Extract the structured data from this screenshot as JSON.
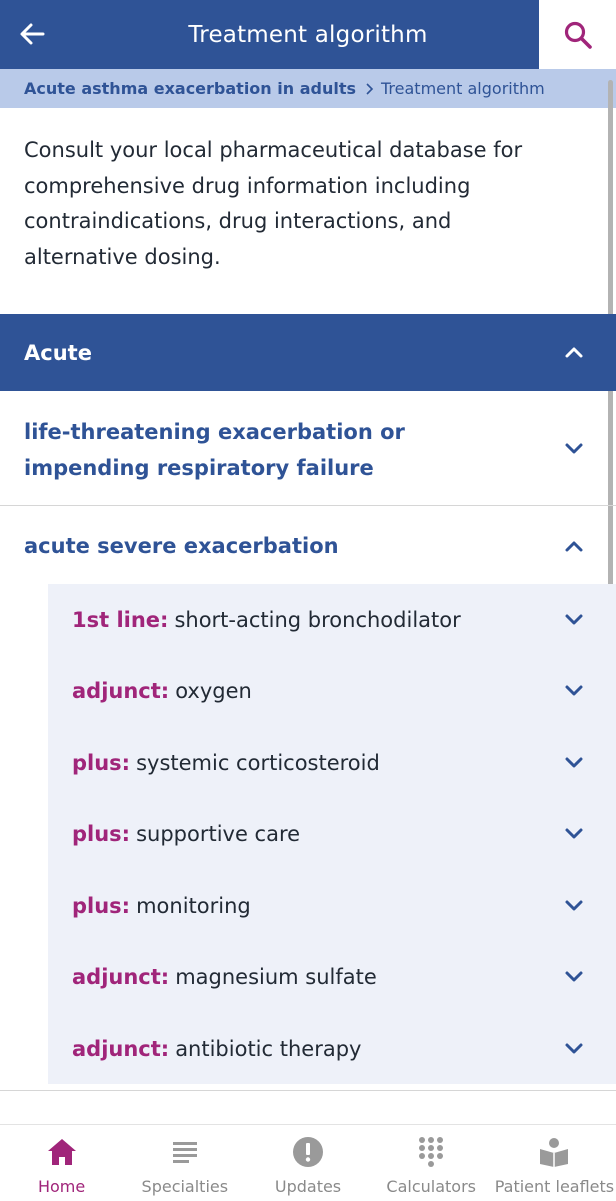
{
  "appbar": {
    "title": "Treatment algorithm"
  },
  "breadcrumb": {
    "parent": "Acute asthma exacerbation in adults",
    "current": "Treatment algorithm"
  },
  "intro": {
    "text": "Consult your local pharmaceutical database for comprehensive drug information including contraindications, drug interactions, and alternative dosing."
  },
  "section": {
    "title": "Acute",
    "expanded": true
  },
  "groups": [
    {
      "title": "life-threatening exacerbation or impending respiratory failure",
      "expanded": false
    },
    {
      "title": "acute severe exacerbation",
      "expanded": true
    }
  ],
  "treatments": [
    {
      "tag": "1st line:",
      "text": "short-acting bronchodilator"
    },
    {
      "tag": "adjunct:",
      "text": "oxygen"
    },
    {
      "tag": "plus:",
      "text": "systemic corticosteroid"
    },
    {
      "tag": "plus:",
      "text": "supportive care"
    },
    {
      "tag": "plus:",
      "text": "monitoring"
    },
    {
      "tag": "adjunct:",
      "text": "magnesium sulfate"
    },
    {
      "tag": "adjunct:",
      "text": "antibiotic therapy"
    }
  ],
  "bottom_nav": [
    {
      "label": "Home",
      "icon": "home-icon",
      "active": true
    },
    {
      "label": "Specialties",
      "icon": "list-icon",
      "active": false
    },
    {
      "label": "Updates",
      "icon": "alert-icon",
      "active": false
    },
    {
      "label": "Calculators",
      "icon": "keypad-icon",
      "active": false
    },
    {
      "label": "Patient leaflets",
      "icon": "leaflet-icon",
      "active": false
    }
  ],
  "colors": {
    "primary": "#2f5396",
    "breadcrumb_bg": "#b9cae9",
    "accent": "#a0257a",
    "subpanel_bg": "#eef1f9"
  }
}
